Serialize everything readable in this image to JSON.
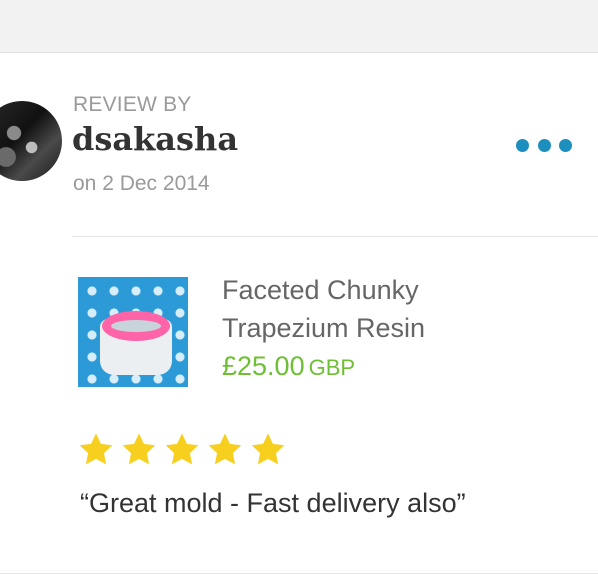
{
  "header": {
    "label": "REVIEW BY"
  },
  "reviewer": {
    "name": "dsakasha",
    "date": "on 2 Dec 2014"
  },
  "more_icon": "more-horizontal-icon",
  "product": {
    "title_line1": "Faceted Chunky",
    "title_line2": "Trapezium Resin",
    "price": "£25.00",
    "currency": "GBP"
  },
  "rating": {
    "stars": 5,
    "max": 5,
    "star_color": "#f7cf1f"
  },
  "review": {
    "text": "“Great mold - Fast delivery also”"
  },
  "colors": {
    "accent": "#1c8fbf",
    "price": "#6fbf35"
  }
}
